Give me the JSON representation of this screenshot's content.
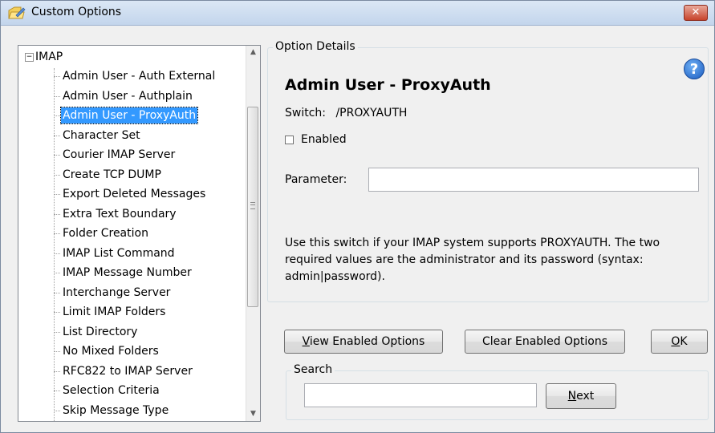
{
  "window": {
    "title": "Custom Options",
    "close_label": "✕"
  },
  "tree": {
    "root": {
      "label": "IMAP",
      "expander": "−"
    },
    "items": [
      {
        "label": "Admin User - Auth External"
      },
      {
        "label": "Admin User - Authplain"
      },
      {
        "label": "Admin User - ProxyAuth",
        "selected": true
      },
      {
        "label": "Character Set"
      },
      {
        "label": "Courier IMAP Server"
      },
      {
        "label": "Create TCP DUMP"
      },
      {
        "label": "Export Deleted Messages"
      },
      {
        "label": "Extra Text Boundary"
      },
      {
        "label": "Folder Creation"
      },
      {
        "label": "IMAP List Command"
      },
      {
        "label": "IMAP Message Number"
      },
      {
        "label": "Interchange Server"
      },
      {
        "label": "Limit IMAP Folders"
      },
      {
        "label": "List Directory"
      },
      {
        "label": "No Mixed Folders"
      },
      {
        "label": "RFC822 to IMAP Server"
      },
      {
        "label": "Selection Criteria"
      },
      {
        "label": "Skip Message Type"
      }
    ]
  },
  "details": {
    "legend": "Option Details",
    "title": "Admin User - ProxyAuth",
    "switch_label": "Switch:",
    "switch_value": "/PROXYAUTH",
    "enabled_label": "Enabled",
    "enabled_checked": false,
    "parameter_label": "Parameter:",
    "parameter_value": "",
    "description": "Use this switch if your IMAP system supports PROXYAUTH. The two required values are the administrator and its password (syntax: admin|password).",
    "help_glyph": "?"
  },
  "buttons": {
    "view_mnemonic": "V",
    "view_rest": "iew Enabled Options",
    "clear": "Clear Enabled Options",
    "ok_mnemonic": "O",
    "ok_rest": "K"
  },
  "search": {
    "legend": "Search",
    "value": "",
    "next_mnemonic": "N",
    "next_rest": "ext"
  },
  "icons": {
    "app": "folder-with-pen-icon",
    "help": "help-icon",
    "scroll_up": "▲",
    "scroll_down": "▼"
  }
}
